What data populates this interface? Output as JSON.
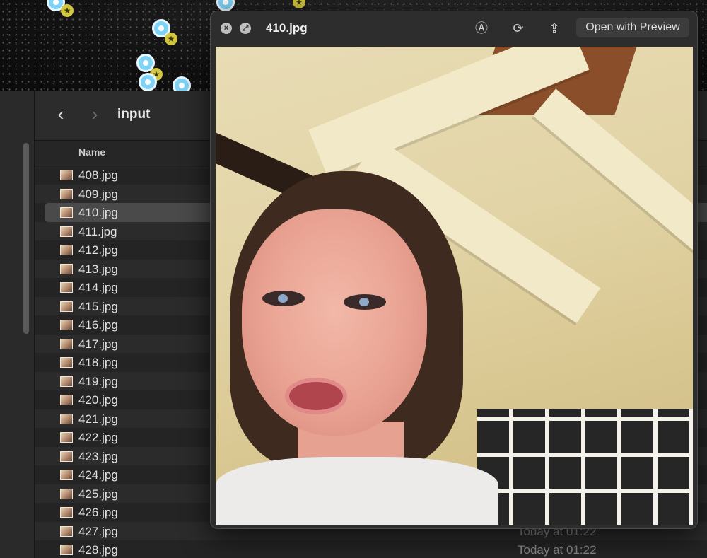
{
  "finder": {
    "folder_title": "input",
    "column_name": "Name",
    "back_glyph": "‹",
    "forward_glyph": "›",
    "files": [
      {
        "name": "408.jpg",
        "date": ""
      },
      {
        "name": "409.jpg",
        "date": ""
      },
      {
        "name": "410.jpg",
        "date": "",
        "selected": true
      },
      {
        "name": "411.jpg",
        "date": ""
      },
      {
        "name": "412.jpg",
        "date": ""
      },
      {
        "name": "413.jpg",
        "date": ""
      },
      {
        "name": "414.jpg",
        "date": ""
      },
      {
        "name": "415.jpg",
        "date": ""
      },
      {
        "name": "416.jpg",
        "date": ""
      },
      {
        "name": "417.jpg",
        "date": ""
      },
      {
        "name": "418.jpg",
        "date": ""
      },
      {
        "name": "419.jpg",
        "date": ""
      },
      {
        "name": "420.jpg",
        "date": ""
      },
      {
        "name": "421.jpg",
        "date": ""
      },
      {
        "name": "422.jpg",
        "date": ""
      },
      {
        "name": "423.jpg",
        "date": ""
      },
      {
        "name": "424.jpg",
        "date": ""
      },
      {
        "name": "425.jpg",
        "date": ""
      },
      {
        "name": "426.jpg",
        "date": ""
      },
      {
        "name": "427.jpg",
        "date": "Today at 01:22"
      },
      {
        "name": "428.jpg",
        "date": "Today at 01:22"
      }
    ]
  },
  "quicklook": {
    "title": "410.jpg",
    "open_button": "Open with Preview",
    "close_glyph": "×",
    "fullscreen_glyph": "⤢",
    "markup_glyph": "Ⓐ",
    "rotate_glyph": "⟳",
    "share_glyph": "⇪"
  },
  "icons": {
    "map_pin": "location-pin-icon",
    "star": "star-icon"
  },
  "colors": {
    "window_bg": "#242424",
    "selection": "#4a4a4a",
    "pin": "#7fd3f7",
    "star": "#d3c640"
  }
}
